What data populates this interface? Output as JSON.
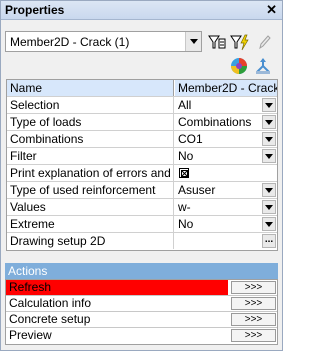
{
  "window": {
    "title": "Properties",
    "close_glyph": "✕"
  },
  "selector": {
    "value": "Member2D - Crack (1)"
  },
  "toolbar": {
    "icons": [
      "filter-icon",
      "filter-lightning-icon",
      "pencil-icon",
      "palette-icon",
      "arrows-icon"
    ]
  },
  "properties": {
    "header": {
      "name": "Name",
      "value": "Member2D - Crack"
    },
    "rows": [
      {
        "label": "Selection",
        "value": "All"
      },
      {
        "label": "Type of loads",
        "value": "Combinations"
      },
      {
        "label": "Combinations",
        "value": "CO1"
      },
      {
        "label": "Filter",
        "value": "No"
      },
      {
        "label": "Print explanation of errors and ...",
        "value": ""
      },
      {
        "label": "Type of used reinforcement",
        "value": "Asuser"
      },
      {
        "label": "Values",
        "value": "w-"
      },
      {
        "label": "Extreme",
        "value": "No"
      },
      {
        "label": "Drawing setup 2D",
        "value": "",
        "button": "..."
      }
    ]
  },
  "actions": {
    "header": "Actions",
    "items": [
      {
        "label": "Refresh",
        "button": ">>>",
        "highlight": "#ff0000"
      },
      {
        "label": "Calculation info",
        "button": ">>>"
      },
      {
        "label": "Concrete setup",
        "button": ">>>"
      },
      {
        "label": "Preview",
        "button": ">>>"
      }
    ]
  }
}
